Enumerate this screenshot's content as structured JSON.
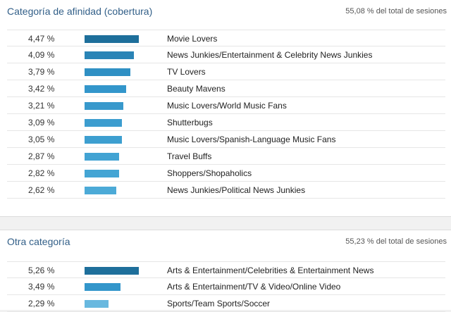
{
  "affinity": {
    "title": "Categoría de afinidad (cobertura)",
    "total": "55,08 % del total de sesiones",
    "max": 4.47,
    "rows": [
      {
        "pct_label": "4,47 %",
        "value": 4.47,
        "label": "Movie Lovers",
        "color": "#1e6f9b"
      },
      {
        "pct_label": "4,09 %",
        "value": 4.09,
        "label": "News Junkies/Entertainment & Celebrity News Junkies",
        "color": "#2a84b6"
      },
      {
        "pct_label": "3,79 %",
        "value": 3.79,
        "label": "TV Lovers",
        "color": "#2f90c4"
      },
      {
        "pct_label": "3,42 %",
        "value": 3.42,
        "label": "Beauty Mavens",
        "color": "#3396cb"
      },
      {
        "pct_label": "3,21 %",
        "value": 3.21,
        "label": "Music Lovers/World Music Fans",
        "color": "#3899cc"
      },
      {
        "pct_label": "3,09 %",
        "value": 3.09,
        "label": "Shutterbugs",
        "color": "#3c9dcf"
      },
      {
        "pct_label": "3,05 %",
        "value": 3.05,
        "label": "Music Lovers/Spanish-Language Music Fans",
        "color": "#3d9fd0"
      },
      {
        "pct_label": "2,87 %",
        "value": 2.87,
        "label": "Travel Buffs",
        "color": "#42a3d3"
      },
      {
        "pct_label": "2,82 %",
        "value": 2.82,
        "label": "Shoppers/Shopaholics",
        "color": "#44a5d4"
      },
      {
        "pct_label": "2,62 %",
        "value": 2.62,
        "label": "News Junkies/Political News Junkies",
        "color": "#4caad7"
      }
    ]
  },
  "other": {
    "title": "Otra categoría",
    "total": "55,23 % del total de sesiones",
    "max": 5.26,
    "rows": [
      {
        "pct_label": "5,26 %",
        "value": 5.26,
        "label": "Arts & Entertainment/Celebrities & Entertainment News",
        "color": "#1e6f9b"
      },
      {
        "pct_label": "3,49 %",
        "value": 3.49,
        "label": "Arts & Entertainment/TV & Video/Online Video",
        "color": "#3396cb"
      },
      {
        "pct_label": "2,29 %",
        "value": 2.29,
        "label": "Sports/Team Sports/Soccer",
        "color": "#68b8df"
      }
    ]
  }
}
